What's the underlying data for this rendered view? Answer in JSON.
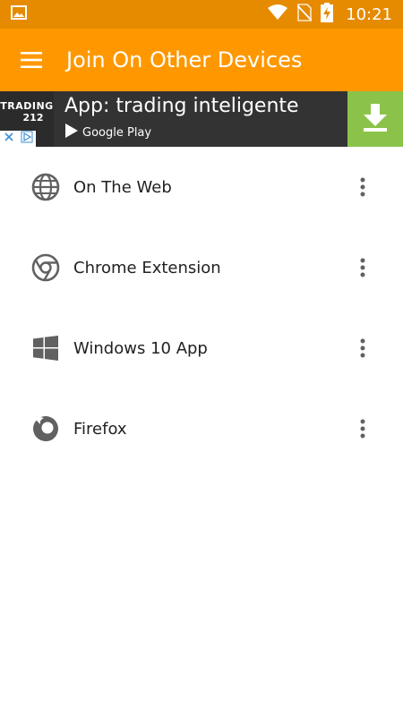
{
  "status_bar": {
    "time": "10:21",
    "icons": [
      "image-notification-icon",
      "wifi-icon",
      "no-sim-icon",
      "battery-charging-icon"
    ]
  },
  "app_bar": {
    "title": "Join On Other Devices",
    "menu_icon": "hamburger-menu-icon"
  },
  "ad": {
    "logo_line1": "TRADING",
    "logo_line2": "212",
    "headline": "App: trading inteligente",
    "store_label": "Google Play",
    "accent_color": "#8bc34a"
  },
  "devices": [
    {
      "label": "On The Web",
      "icon": "globe-icon"
    },
    {
      "label": "Chrome Extension",
      "icon": "chrome-icon"
    },
    {
      "label": "Windows 10 App",
      "icon": "windows-icon"
    },
    {
      "label": "Firefox",
      "icon": "firefox-icon"
    }
  ],
  "colors": {
    "status_bar": "#e68a00",
    "app_bar": "#ff9800",
    "icon_gray": "#616161"
  }
}
